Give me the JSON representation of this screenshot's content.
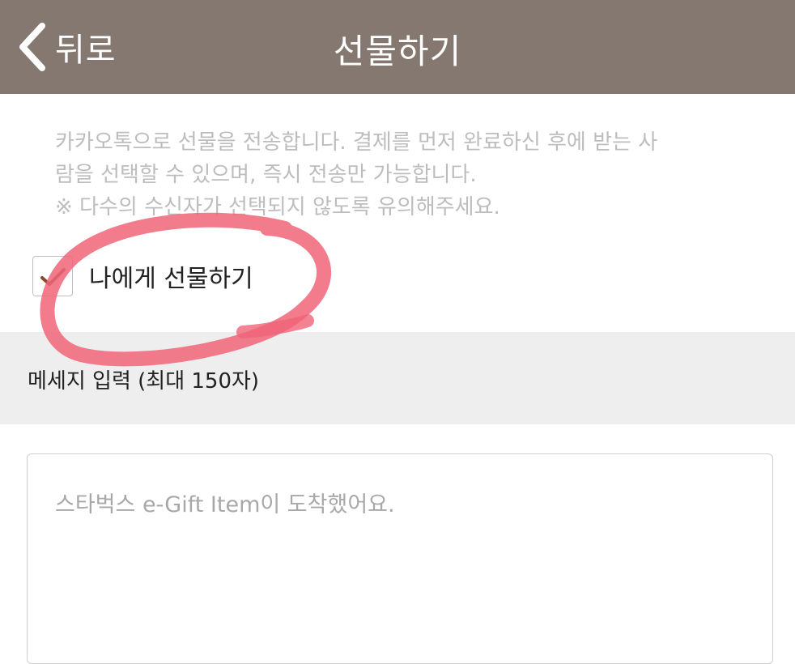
{
  "header": {
    "back_label": "뒤로",
    "title": "선물하기",
    "back_icon": "chevron-left-icon"
  },
  "notice": {
    "line1": "카카오톡으로 선물을 전송합니다. 결제를 먼저 완료하신 후에 받는 사",
    "line2": "람을 선택할 수 있으며, 즉시 전송만 가능합니다.",
    "line3": "※ 다수의 수신자가 선택되지 않도록 유의해주세요."
  },
  "self_gift": {
    "label": "나에게 선물하기",
    "checked": true,
    "check_icon": "checkmark-icon"
  },
  "message_section": {
    "label": "메세지 입력 (최대 150자)"
  },
  "message_input": {
    "placeholder": "스타벅스 e-Gift Item이 도착했어요."
  },
  "colors": {
    "header_bg": "#857870",
    "checkmark": "#8b4a2b",
    "annotation": "#f06478"
  }
}
